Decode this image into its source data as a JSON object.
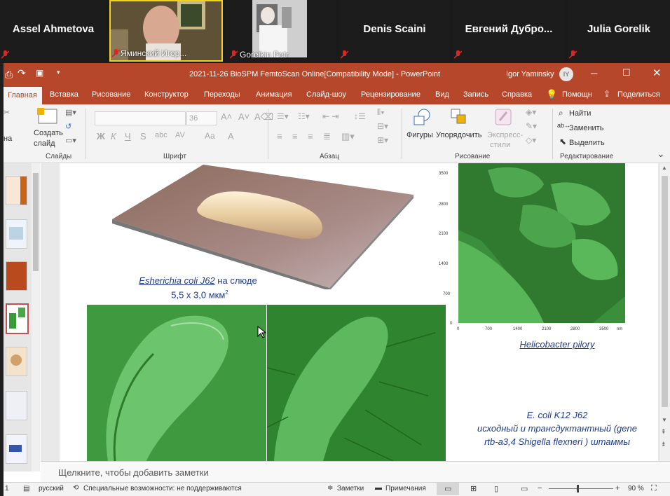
{
  "participants": [
    {
      "name": "Assel Ahmetova"
    },
    {
      "name": "Ямин­ский Игор...",
      "label": "Яминский Игор..."
    },
    {
      "name": "Gorelkin Petr",
      "label": "Gorelkin Petr"
    },
    {
      "name": "Denis Scaini"
    },
    {
      "name": "Евгений  Дубро..."
    },
    {
      "name": "Julia Gorelik"
    }
  ],
  "window": {
    "title": "2021-11-26 BioSPM FemtoScan Online[Compatibility Mode]  -  PowerPoint",
    "user": "Igor Yaminsky",
    "user_initials": "IY"
  },
  "tabs": [
    "Главная",
    "Вставка",
    "Рисование",
    "Конструктор",
    "Переходы",
    "Анимация",
    "Слайд-шоу",
    "Рецензирование",
    "Вид",
    "Запись",
    "Справка",
    "Помощн",
    "Поделиться"
  ],
  "ribbon": {
    "create_slide": "Создать",
    "create_slide2": "слайд",
    "slides_label": "Слайды",
    "font_size": "36",
    "font_label": "Шрифт",
    "paragraph_label": "Абзац",
    "shapes": "Фигуры",
    "arrange": "Упорядочить",
    "express": "Экспресс-",
    "styles": "стили",
    "drawing_label": "Рисование",
    "find": "Найти",
    "replace": "Заменить",
    "select": "Выделить",
    "editing_label": "Редактирование",
    "left_partial": "на",
    "bold": "Ж",
    "italic": "К",
    "underline": "Ч",
    "strike": "S",
    "spacing": "AV",
    "case": "Aa",
    "color": "A"
  },
  "slide": {
    "caption1_italic": "Esherichia coli J62",
    "caption1_rest": " на слюде",
    "caption2": "5,5 x 3,0 мкм",
    "caption2_sup": "2",
    "helicobacter": "Helicobacter pilory",
    "ecoli_title": "E. coli K12 J62",
    "ecoli_line2": "исходный и трансдуктантный (gene",
    "ecoli_line3": "rtb-a3,4 Shigella flexneri ) штаммы",
    "afm_y_ticks": [
      "3500",
      "2800",
      "2100",
      "1400",
      "700",
      "0"
    ],
    "afm_x_ticks": [
      "0",
      "700",
      "1400",
      "2100",
      "2800",
      "3500",
      "nm"
    ]
  },
  "notes_placeholder": "Щелкните, чтобы добавить заметки",
  "status": {
    "slide_num": "1",
    "language": "русский",
    "accessibility": "Специальные возможности: не поддерживаются",
    "notes": "Заметки",
    "comments": "Примечания",
    "zoom": "90 %"
  },
  "colors": {
    "accent": "#b7472a",
    "caption": "#1f3c8c"
  }
}
